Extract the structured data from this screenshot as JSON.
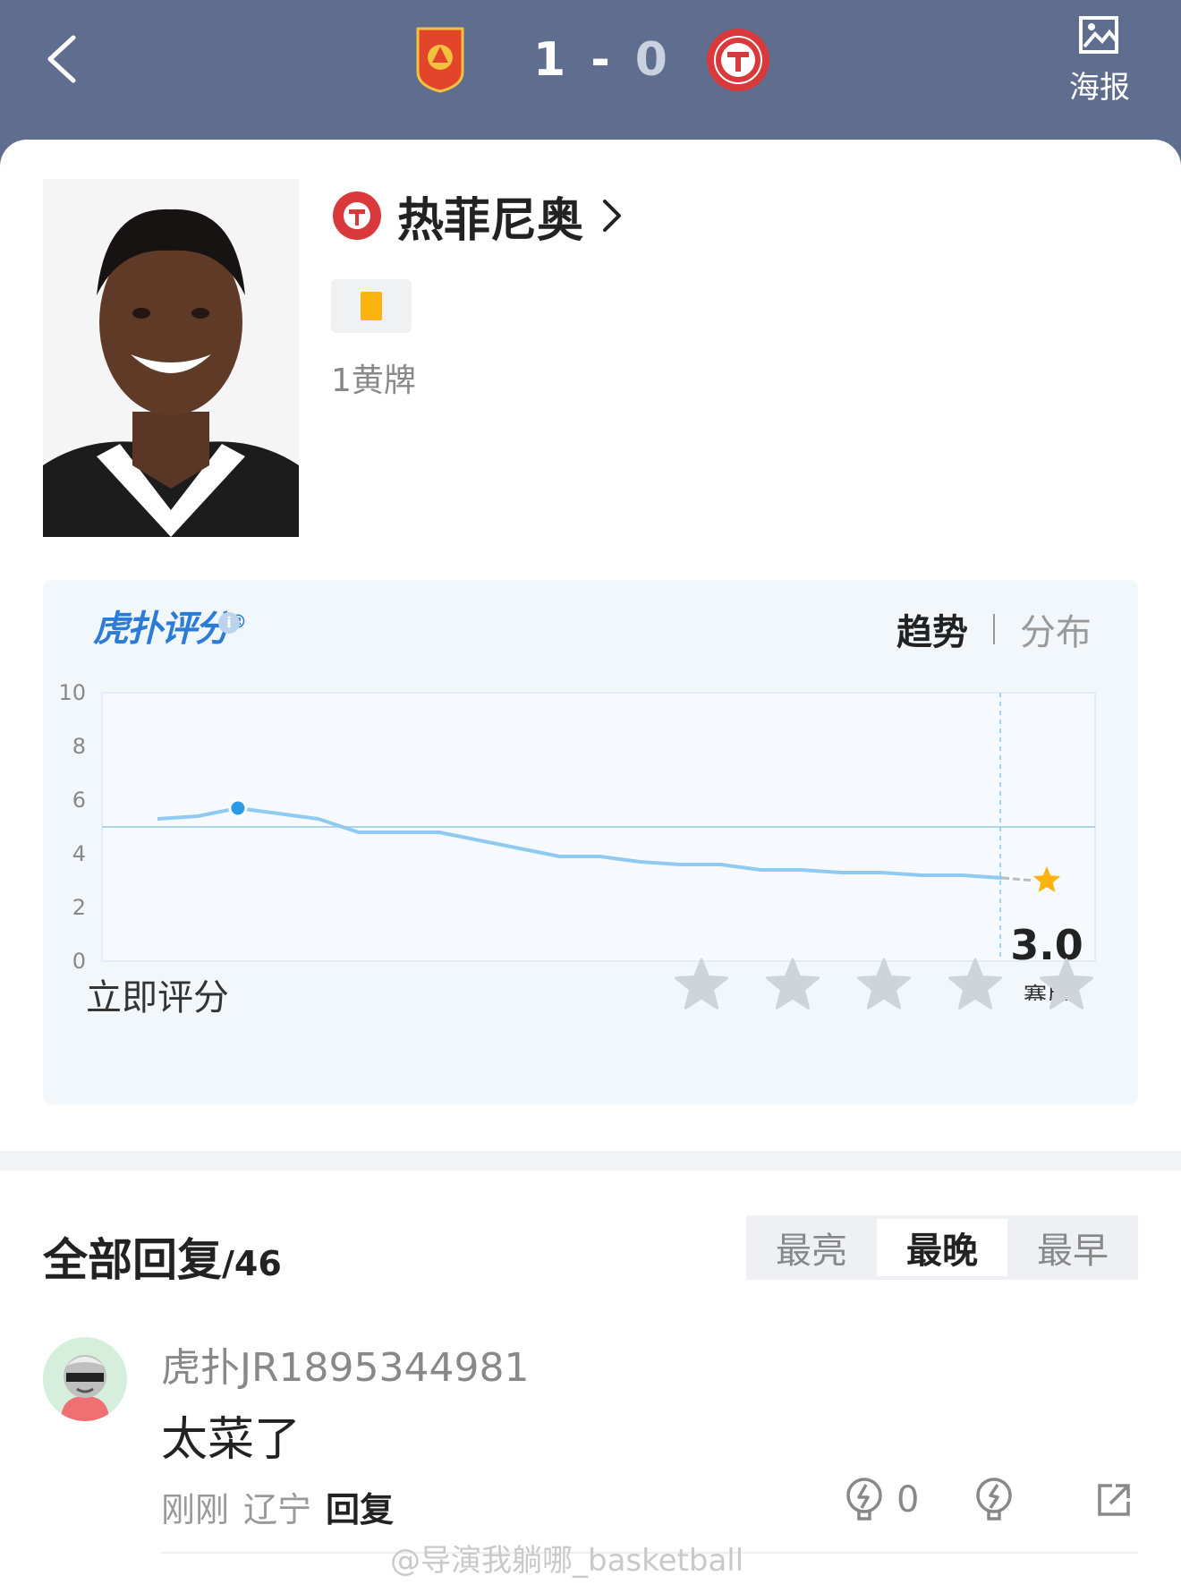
{
  "match": {
    "home_score": "1",
    "separator": "-",
    "away_score": "0",
    "poster_label": "海报"
  },
  "player": {
    "name": "热菲尼奥",
    "event_text": "1黄牌"
  },
  "rating": {
    "brand": "虎扑评分",
    "brand_mark": "®",
    "tab_trend": "趋势",
    "tab_distribution": "分布",
    "current_score": "3.0",
    "current_label": "赛后",
    "rate_now_label": "立即评分",
    "star_count": 5
  },
  "chart_data": {
    "type": "line",
    "title": "",
    "xlabel": "",
    "ylabel": "",
    "ylim": [
      0,
      10
    ],
    "yticks": [
      "0",
      "2",
      "4",
      "6",
      "8",
      "10"
    ],
    "reference_line": 5.0,
    "series": [
      {
        "values": [
          5.3,
          5.4,
          5.7,
          5.5,
          5.3,
          4.8,
          4.8,
          4.8,
          4.5,
          4.2,
          3.9,
          3.9,
          3.7,
          3.6,
          3.6,
          3.4,
          3.4,
          3.3,
          3.3,
          3.2,
          3.2,
          3.1
        ],
        "highlight_index": 2
      }
    ],
    "final_value": 3.0,
    "final_label": "赛后",
    "colors": {
      "line": "#8fcaf0",
      "point": "#2b9be8",
      "star": "#fbb30d",
      "ref": "#a9d4f2"
    }
  },
  "replies": {
    "title": "全部回复",
    "count": "/46",
    "sort_options": [
      "最亮",
      "最晚",
      "最早"
    ],
    "active_sort": "最晚",
    "items": [
      {
        "username": "虎扑JR1895344981",
        "text": "太菜了",
        "time": "刚刚",
        "location": "辽宁",
        "reply_label": "回复",
        "likes": "0"
      }
    ]
  },
  "watermark": "@导演我躺哪_basketball"
}
